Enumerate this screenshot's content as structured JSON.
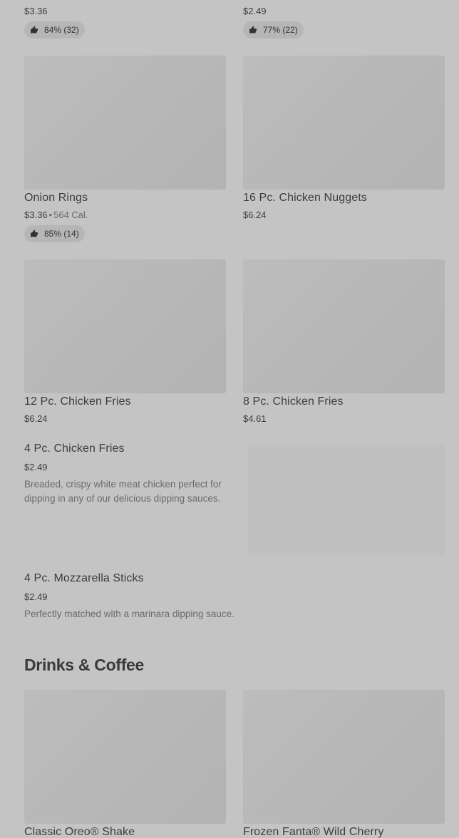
{
  "items": {
    "top_left": {
      "price": "$3.36",
      "rating": "84% (32)"
    },
    "top_right": {
      "price": "$2.49",
      "rating": "77% (22)"
    },
    "onion_rings": {
      "name": "Onion Rings",
      "price": "$3.36",
      "separator": "•",
      "calories": "564 Cal.",
      "rating": "85% (14)"
    },
    "nuggets_16": {
      "name": "16 Pc. Chicken Nuggets",
      "price": "$6.24"
    },
    "fries_12": {
      "name": "12 Pc. Chicken Fries",
      "price": "$6.24"
    },
    "fries_8": {
      "name": "8 Pc. Chicken Fries",
      "price": "$4.61"
    },
    "fries_4": {
      "name": "4 Pc. Chicken Fries",
      "price": "$2.49",
      "description": "Breaded, crispy white meat chicken perfect for dipping in any of our delicious dipping sauces."
    },
    "mozzarella_4": {
      "name": "4 Pc. Mozzarella Sticks",
      "price": "$2.49",
      "description": "Perfectly matched with a marinara dipping sauce."
    }
  },
  "drinks": {
    "section_title": "Drinks & Coffee",
    "oreo_shake": {
      "name": "Classic Oreo® Shake"
    },
    "fanta": {
      "name": "Frozen Fanta® Wild Cherry"
    }
  },
  "icons": {
    "rating": "thumbs-up-icon"
  }
}
